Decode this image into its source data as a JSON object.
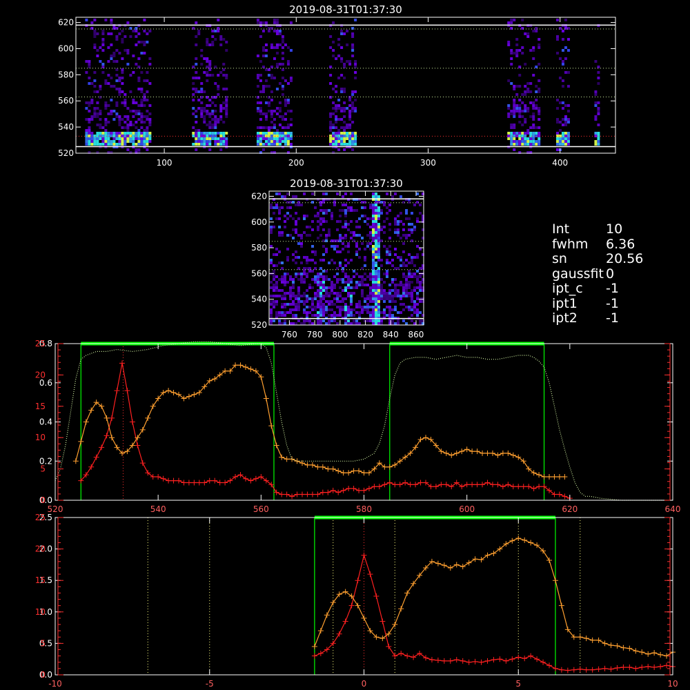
{
  "colors": {
    "background": "#000000",
    "axis": "#ffffff",
    "red_series": "#ff2020",
    "orange_series": "#ffa030",
    "filter_band": "#00ff00",
    "filter_curve": "#d0f0a0",
    "red_guide": "#ff3030",
    "yellow_guide": "#ffff80",
    "secondary_axis": "#ff3030",
    "tick_labels_bottom": "#ff6060"
  },
  "info": {
    "lines": [
      {
        "k": "Int",
        "v": "10"
      },
      {
        "k": "fwhm",
        "v": "6.36"
      },
      {
        "k": "sn",
        "v": "20.56"
      },
      {
        "k": "gaussfit",
        "v": "0"
      },
      {
        "k": "ipt_c",
        "v": "-1"
      },
      {
        "k": "ipt1",
        "v": "-1"
      },
      {
        "k": "ipt2",
        "v": "-1"
      }
    ]
  },
  "chart_data": [
    {
      "type": "heatmap",
      "title": "2019-08-31T01:37:30",
      "xlim": [
        33,
        442
      ],
      "ylim": [
        520,
        624
      ],
      "x_ticks": [
        "100",
        "200",
        "300",
        "400"
      ],
      "y_ticks": [
        "520",
        "540",
        "560",
        "580",
        "600",
        "620"
      ],
      "white_lines_y": [
        525,
        618
      ],
      "dotted_lines_y": [
        563,
        585,
        615
      ],
      "red_dotted_line_y": 533,
      "bright_columns": [
        {
          "x0": 40,
          "x1": 90
        },
        {
          "x0": 121,
          "x1": 147
        },
        {
          "x0": 170,
          "x1": 196
        },
        {
          "x0": 225,
          "x1": 245
        },
        {
          "x0": 360,
          "x1": 385
        },
        {
          "x0": 397,
          "x1": 406
        },
        {
          "x0": 426,
          "x1": 429
        }
      ]
    },
    {
      "type": "heatmap",
      "title": "2019-08-31T01:37:30",
      "xlim": [
        744,
        866
      ],
      "ylim": [
        520,
        624
      ],
      "x_ticks": [
        "760",
        "780",
        "800",
        "820",
        "840",
        "860"
      ],
      "y_ticks": [
        "520",
        "540",
        "560",
        "580",
        "600",
        "620"
      ],
      "white_lines_y": [
        525,
        618
      ],
      "dotted_lines_y": [
        563,
        585,
        615
      ]
    },
    {
      "type": "line",
      "xlim": [
        520,
        640
      ],
      "x_ticks": [
        "520",
        "540",
        "560",
        "580",
        "600",
        "620",
        "640"
      ],
      "left_axis_a": {
        "ylim": [
          0.0,
          0.8
        ],
        "ticks": [
          "0.0",
          "0.2",
          "0.4",
          "0.6",
          "0.8"
        ]
      },
      "left_axis_b": {
        "ylim": [
          0,
          25
        ],
        "ticks": [
          "0",
          "5",
          "10",
          "15",
          "20",
          "25"
        ]
      },
      "filter_bands": [
        [
          525,
          562.5
        ],
        [
          585,
          615
        ]
      ],
      "red_guide_x": 533.2,
      "series": [
        {
          "color": "red",
          "x": [
            525,
            526,
            527,
            528,
            529,
            530,
            531,
            532,
            533,
            534,
            535,
            536,
            537,
            538,
            539,
            540,
            541,
            542,
            543,
            544,
            545,
            546,
            547,
            548,
            549,
            550,
            551,
            552,
            553,
            554,
            555,
            556,
            557,
            558,
            559,
            560,
            561,
            562,
            563,
            564,
            565,
            566,
            567,
            568,
            569,
            570,
            571,
            572,
            573,
            574,
            575,
            576,
            577,
            578,
            579,
            580,
            581,
            582,
            583,
            584,
            585,
            586,
            587,
            588,
            589,
            590,
            591,
            592,
            593,
            594,
            595,
            596,
            597,
            598,
            599,
            600,
            601,
            602,
            603,
            604,
            605,
            606,
            607,
            608,
            609,
            610,
            611,
            612,
            613,
            614,
            615,
            616,
            617,
            618,
            619,
            620
          ],
          "y": [
            0.1,
            0.13,
            0.17,
            0.22,
            0.27,
            0.33,
            0.42,
            0.56,
            0.7,
            0.56,
            0.4,
            0.28,
            0.19,
            0.14,
            0.12,
            0.12,
            0.11,
            0.1,
            0.1,
            0.1,
            0.09,
            0.09,
            0.09,
            0.09,
            0.09,
            0.1,
            0.1,
            0.09,
            0.09,
            0.1,
            0.12,
            0.13,
            0.11,
            0.1,
            0.11,
            0.12,
            0.1,
            0.08,
            0.04,
            0.03,
            0.03,
            0.02,
            0.03,
            0.03,
            0.03,
            0.03,
            0.03,
            0.04,
            0.04,
            0.05,
            0.04,
            0.05,
            0.06,
            0.06,
            0.05,
            0.05,
            0.06,
            0.07,
            0.07,
            0.08,
            0.09,
            0.08,
            0.08,
            0.09,
            0.08,
            0.08,
            0.09,
            0.09,
            0.07,
            0.07,
            0.08,
            0.08,
            0.07,
            0.09,
            0.07,
            0.08,
            0.08,
            0.08,
            0.08,
            0.09,
            0.08,
            0.08,
            0.07,
            0.08,
            0.07,
            0.07,
            0.07,
            0.07,
            0.06,
            0.07,
            0.07,
            0.05,
            0.03,
            0.03,
            0.02,
            0.01
          ]
        },
        {
          "color": "orange",
          "x": [
            524,
            525,
            526,
            527,
            528,
            529,
            530,
            531,
            532,
            533,
            534,
            535,
            536,
            537,
            538,
            539,
            540,
            541,
            542,
            543,
            544,
            545,
            546,
            547,
            548,
            549,
            550,
            551,
            552,
            553,
            554,
            555,
            556,
            557,
            558,
            559,
            560,
            561,
            562,
            563,
            564,
            565,
            566,
            567,
            568,
            569,
            570,
            571,
            572,
            573,
            574,
            575,
            576,
            577,
            578,
            579,
            580,
            581,
            582,
            583,
            584,
            585,
            586,
            587,
            588,
            589,
            590,
            591,
            592,
            593,
            594,
            595,
            596,
            597,
            598,
            599,
            600,
            601,
            602,
            603,
            604,
            605,
            606,
            607,
            608,
            609,
            610,
            611,
            612,
            613,
            614,
            615,
            616,
            617,
            618,
            619
          ],
          "y": [
            0.2,
            0.3,
            0.4,
            0.46,
            0.5,
            0.48,
            0.42,
            0.32,
            0.27,
            0.24,
            0.25,
            0.28,
            0.32,
            0.36,
            0.42,
            0.48,
            0.52,
            0.55,
            0.56,
            0.55,
            0.54,
            0.52,
            0.53,
            0.54,
            0.55,
            0.58,
            0.61,
            0.62,
            0.64,
            0.66,
            0.66,
            0.69,
            0.69,
            0.68,
            0.67,
            0.66,
            0.63,
            0.52,
            0.38,
            0.28,
            0.22,
            0.21,
            0.21,
            0.2,
            0.19,
            0.18,
            0.18,
            0.17,
            0.17,
            0.16,
            0.16,
            0.15,
            0.14,
            0.14,
            0.15,
            0.15,
            0.14,
            0.14,
            0.16,
            0.19,
            0.17,
            0.17,
            0.18,
            0.2,
            0.22,
            0.24,
            0.27,
            0.31,
            0.32,
            0.31,
            0.28,
            0.25,
            0.24,
            0.23,
            0.24,
            0.25,
            0.26,
            0.25,
            0.25,
            0.24,
            0.24,
            0.24,
            0.23,
            0.24,
            0.24,
            0.23,
            0.22,
            0.2,
            0.16,
            0.14,
            0.13,
            0.12,
            0.12,
            0.12,
            0.12,
            0.12
          ]
        },
        {
          "color": "filter-curve-dotted",
          "x": [
            520,
            521,
            522,
            523,
            524,
            525,
            526,
            527,
            528,
            529,
            530,
            532,
            535,
            538,
            541,
            544,
            547,
            550,
            553,
            556,
            559,
            560,
            561,
            562,
            563,
            564,
            565,
            566,
            567,
            568,
            570,
            572,
            574,
            576,
            578,
            580,
            582,
            583,
            584,
            585,
            586,
            587,
            588,
            590,
            592,
            594,
            596,
            598,
            600,
            602,
            604,
            606,
            608,
            610,
            612,
            613,
            614,
            615,
            616,
            617,
            618,
            619,
            620,
            621,
            622,
            623,
            624,
            626,
            630,
            635,
            640
          ],
          "y": [
            0.1,
            0.16,
            0.28,
            0.45,
            0.62,
            0.72,
            0.74,
            0.75,
            0.76,
            0.76,
            0.76,
            0.77,
            0.76,
            0.77,
            0.79,
            0.8,
            0.81,
            0.81,
            0.8,
            0.79,
            0.8,
            0.8,
            0.78,
            0.7,
            0.55,
            0.4,
            0.28,
            0.21,
            0.2,
            0.2,
            0.2,
            0.2,
            0.2,
            0.2,
            0.2,
            0.21,
            0.24,
            0.29,
            0.38,
            0.52,
            0.64,
            0.7,
            0.72,
            0.73,
            0.73,
            0.72,
            0.73,
            0.74,
            0.73,
            0.73,
            0.72,
            0.72,
            0.73,
            0.74,
            0.74,
            0.73,
            0.71,
            0.68,
            0.6,
            0.48,
            0.36,
            0.26,
            0.17,
            0.09,
            0.04,
            0.02,
            0.02,
            0.01,
            0.0,
            0.0,
            0.0
          ]
        }
      ]
    },
    {
      "type": "line",
      "xlim": [
        -10,
        10
      ],
      "x_ticks": [
        "-10",
        "-5",
        "0",
        "5",
        "10"
      ],
      "left_axis_a": {
        "ylim": [
          0.0,
          2.5
        ],
        "ticks": [
          "0.0",
          "0.5",
          "1.0",
          "1.5",
          "2.0",
          "2.5"
        ]
      },
      "left_axis_b": {
        "ylim": [
          0,
          25
        ],
        "ticks": [
          "0",
          "5",
          "10",
          "15",
          "20",
          "25"
        ]
      },
      "filter_bands": [
        [
          -1.6,
          6.2
        ]
      ],
      "red_guide_x": 0,
      "yellow_guides_x": [
        -7,
        -5,
        -1,
        1,
        5,
        7
      ],
      "series": [
        {
          "color": "red",
          "x": [
            -1.6,
            -1.4,
            -1.2,
            -1.0,
            -0.8,
            -0.6,
            -0.4,
            -0.2,
            0.0,
            0.2,
            0.4,
            0.6,
            0.8,
            1.0,
            1.2,
            1.4,
            1.6,
            1.8,
            2.0,
            2.2,
            2.4,
            2.6,
            2.8,
            3.0,
            3.2,
            3.4,
            3.6,
            3.8,
            4.0,
            4.2,
            4.4,
            4.6,
            4.8,
            5.0,
            5.2,
            5.4,
            5.6,
            5.8,
            6.0,
            6.2,
            6.4,
            6.6,
            6.8,
            7.0,
            7.2,
            7.4,
            7.6,
            7.8,
            8.0,
            8.2,
            8.4,
            8.6,
            8.8,
            9.0,
            9.2,
            9.4,
            9.6,
            9.8,
            10.0
          ],
          "y": [
            0.3,
            0.34,
            0.4,
            0.5,
            0.65,
            0.85,
            1.1,
            1.5,
            1.9,
            1.6,
            1.25,
            0.85,
            0.45,
            0.3,
            0.34,
            0.3,
            0.28,
            0.34,
            0.27,
            0.24,
            0.23,
            0.22,
            0.22,
            0.24,
            0.22,
            0.2,
            0.21,
            0.2,
            0.22,
            0.24,
            0.25,
            0.22,
            0.25,
            0.28,
            0.26,
            0.3,
            0.25,
            0.2,
            0.15,
            0.1,
            0.08,
            0.07,
            0.08,
            0.09,
            0.08,
            0.08,
            0.09,
            0.1,
            0.09,
            0.11,
            0.12,
            0.12,
            0.1,
            0.12,
            0.13,
            0.12,
            0.13,
            0.15,
            0.13
          ]
        },
        {
          "color": "orange",
          "x": [
            -1.6,
            -1.4,
            -1.2,
            -1.0,
            -0.8,
            -0.6,
            -0.4,
            -0.2,
            0.0,
            0.2,
            0.4,
            0.6,
            0.8,
            1.0,
            1.2,
            1.4,
            1.6,
            1.8,
            2.0,
            2.2,
            2.4,
            2.6,
            2.8,
            3.0,
            3.2,
            3.4,
            3.6,
            3.8,
            4.0,
            4.2,
            4.4,
            4.6,
            4.8,
            5.0,
            5.2,
            5.4,
            5.6,
            5.8,
            6.0,
            6.2,
            6.4,
            6.6,
            6.8,
            7.0,
            7.2,
            7.4,
            7.6,
            7.8,
            8.0,
            8.2,
            8.4,
            8.6,
            8.8,
            9.0,
            9.2,
            9.4,
            9.6,
            9.8,
            10.0
          ],
          "y": [
            0.45,
            0.7,
            0.95,
            1.15,
            1.28,
            1.32,
            1.25,
            1.1,
            0.9,
            0.7,
            0.6,
            0.58,
            0.65,
            0.8,
            1.05,
            1.3,
            1.45,
            1.58,
            1.7,
            1.8,
            1.77,
            1.74,
            1.7,
            1.75,
            1.72,
            1.78,
            1.84,
            1.83,
            1.9,
            1.93,
            2.0,
            2.08,
            2.13,
            2.17,
            2.14,
            2.1,
            2.06,
            1.97,
            1.82,
            1.5,
            1.1,
            0.72,
            0.6,
            0.6,
            0.58,
            0.55,
            0.55,
            0.5,
            0.47,
            0.46,
            0.43,
            0.42,
            0.38,
            0.36,
            0.33,
            0.35,
            0.32,
            0.3,
            0.36
          ]
        }
      ]
    }
  ]
}
